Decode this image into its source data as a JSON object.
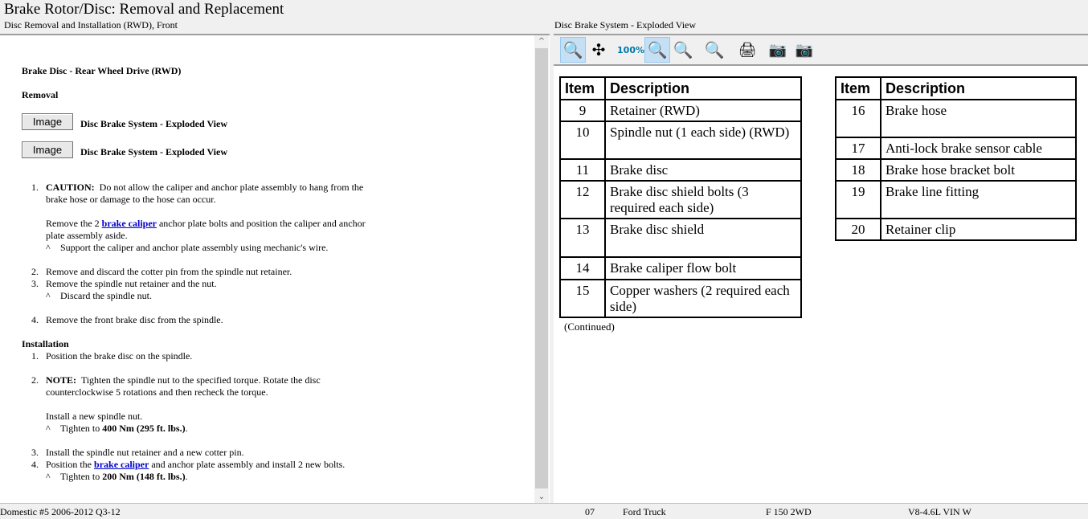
{
  "title": "Brake Rotor/Disc:  Removal and Replacement",
  "left_header": "Disc Removal and Installation (RWD), Front",
  "right_header": "Disc Brake System - Exploded View",
  "doc": {
    "heading": "Brake Disc - Rear Wheel Drive (RWD)",
    "removal": "Removal",
    "image_button": "Image",
    "image_link_1": "Disc Brake System - Exploded View",
    "image_link_2": "Disc Brake System - Exploded View",
    "s1_num": "1.",
    "s1_caution": "CAUTION:",
    "s1_a": "Do not allow the caliper and anchor plate assembly to hang from the",
    "s1_b": "brake hose or damage to the hose can occur.",
    "s1_c_pre": "Remove the 2 ",
    "s1_link": "brake caliper",
    "s1_c_post": " anchor plate bolts and position the caliper and anchor",
    "s1_d": "plate assembly aside.",
    "caret": "^",
    "s1_sub": "Support the caliper and anchor plate assembly using mechanic's wire.",
    "s2_num": "2.",
    "s2": "Remove and discard the cotter pin from the spindle nut retainer.",
    "s3_num": "3.",
    "s3": "Remove the spindle nut retainer and the nut.",
    "s3_sub": "Discard the spindle nut.",
    "s4_num": "4.",
    "s4": "Remove the front brake disc from the spindle.",
    "installation": "Installation",
    "i1_num": "1.",
    "i1": "Position the brake disc on the spindle.",
    "i2_num": "2.",
    "i2_note": "NOTE:",
    "i2_a": "Tighten the spindle nut to the specified torque. Rotate the disc",
    "i2_b": "counterclockwise 5 rotations and then recheck the torque.",
    "i2_c": "Install a new spindle nut.",
    "i2_sub_pre": "Tighten to ",
    "i2_sub_val": "400 Nm (295 ft. lbs.)",
    "i2_sub_post": ".",
    "i3_num": "3.",
    "i3": "Install the spindle nut retainer and a new cotter pin.",
    "i4_num": "4.",
    "i4_pre": "Position the ",
    "i4_link": "brake caliper",
    "i4_post": " and anchor plate assembly and install 2 new bolts.",
    "i4_sub_pre": "Tighten to ",
    "i4_sub_val": "200 Nm (148 ft. lbs.)",
    "i4_sub_post": "."
  },
  "toolbar": [
    "zoom-in",
    "pan",
    "zoom-100",
    "zoom-fit",
    "zoom-width",
    "zoom-out",
    "print",
    "copy-image",
    "paste-image"
  ],
  "table_headers": {
    "item": "Item",
    "description": "Description"
  },
  "table1": [
    {
      "item": "9",
      "desc": "Retainer (RWD)"
    },
    {
      "item": "10",
      "desc": "Spindle nut (1 each side) (RWD)"
    },
    {
      "item": "11",
      "desc": "Brake disc"
    },
    {
      "item": "12",
      "desc": "Brake disc shield bolts (3 required each side)"
    },
    {
      "item": "13",
      "desc": "Brake disc shield"
    },
    {
      "item": "14",
      "desc": "Brake caliper flow bolt"
    },
    {
      "item": "15",
      "desc": "Copper washers (2 required each side)"
    }
  ],
  "table2": [
    {
      "item": "16",
      "desc": "Brake hose"
    },
    {
      "item": "17",
      "desc": "Anti-lock brake sensor cable"
    },
    {
      "item": "18",
      "desc": "Brake hose bracket bolt"
    },
    {
      "item": "19",
      "desc": "Brake line fitting"
    },
    {
      "item": "20",
      "desc": "Retainer clip"
    }
  ],
  "continued": "(Continued)",
  "status": {
    "db": "Domestic #5 2006-2012 Q3-12",
    "year": "07",
    "make": "Ford Truck",
    "model": "F 150 2WD",
    "engine": "V8-4.6L VIN W"
  }
}
